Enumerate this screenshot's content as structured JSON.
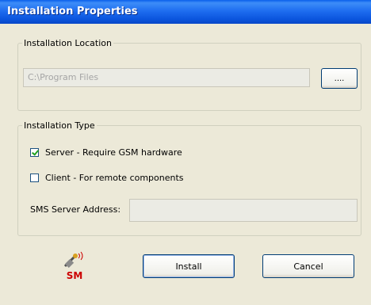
{
  "window": {
    "title": "Installation Properties"
  },
  "location": {
    "legend": "Installation Location",
    "path_value": "C:\\Program Files",
    "browse_label": "...."
  },
  "type": {
    "legend": "Installation Type",
    "server_label": "Server - Require GSM hardware",
    "server_checked": true,
    "client_label": "Client - For remote components",
    "client_checked": false,
    "address_label": "SMS Server Address:",
    "address_value": ""
  },
  "buttons": {
    "install": "Install",
    "cancel": "Cancel"
  },
  "logo": {
    "text": "SM",
    "icon": "sms-antenna-logo-icon"
  },
  "colors": {
    "titlebar": "#0B55DE",
    "dialog_bg": "#ECE9D8",
    "button_border": "#003C74",
    "checkmark": "#21A121",
    "logo_red": "#CC0000"
  }
}
